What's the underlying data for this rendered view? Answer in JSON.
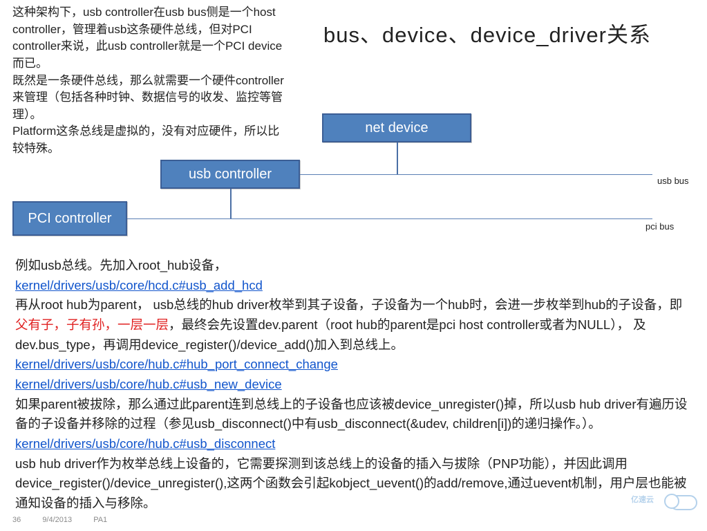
{
  "title": "bus、device、device_driver关系",
  "top_text": {
    "p1": "这种架构下，usb controller在usb bus侧是一个host controller，管理着usb这条硬件总线，但对PCI controller来说，此usb controller就是一个PCI device而已。",
    "p2": "既然是一条硬件总线，那么就需要一个硬件controller来管理（包括各种时钟、数据信号的收发、监控等管理）。",
    "p3": "Platform这条总线是虚拟的，没有对应硬件，所以比较特殊。"
  },
  "boxes": {
    "net": "net device",
    "usb": "usb controller",
    "pci": "PCI controller"
  },
  "bus_labels": {
    "usb": "usb  bus",
    "pci": "pci bus"
  },
  "body": {
    "b1": "例如usb总线。先加入root_hub设备，",
    "link1": "kernel/drivers/usb/core/hcd.c#usb_add_hcd",
    "b2a": "再从root hub为parent， usb总线的hub driver枚举到其子设备，子设备为一个hub时，会进一步枚举到hub的子设备，即",
    "b2red": "父有子，子有孙，一层一层",
    "b2b": "，最终会先设置dev.parent（root hub的parent是pci host controller或者为NULL）， 及dev.bus_type，再调用device_register()/device_add()加入到总线上。",
    "link2": "kernel/drivers/usb/core/hub.c#hub_port_connect_change",
    "link3": "kernel/drivers/usb/core/hub.c#usb_new_device",
    "b3": "如果parent被拔除，那么通过此parent连到总线上的子设备也应该被device_unregister()掉，所以usb hub driver有遍历设备的子设备并移除的过程（参见usb_disconnect()中有usb_disconnect(&udev, children[i])的递归操作。）。",
    "link4": "kernel/drivers/usb/core/hub.c#usb_disconnect",
    "b4": "usb hub driver作为枚举总线上设备的，它需要探测到该总线上的设备的插入与拔除（PNP功能），并因此调用device_register()/device_unregister(),这两个函数会引起kobject_uevent()的add/remove,通过uevent机制，用户层也能被通知设备的插入与移除。"
  },
  "footer": {
    "page": "36",
    "date": "9/4/2013",
    "tag": "PA1"
  },
  "watermark": "亿速云"
}
